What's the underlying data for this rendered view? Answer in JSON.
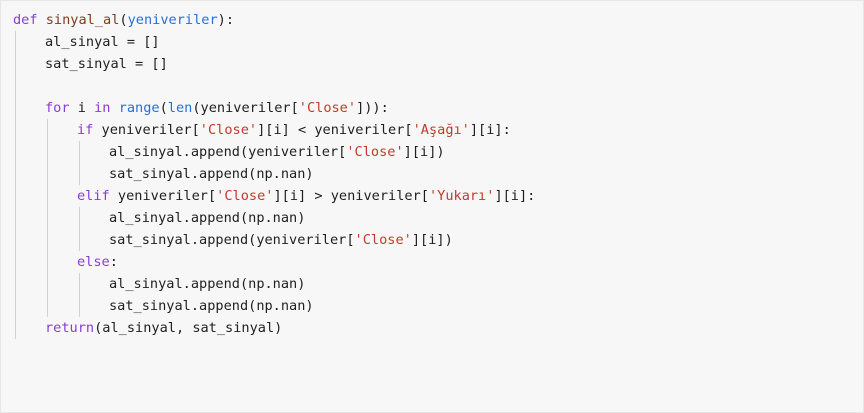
{
  "editor": {
    "language": "python",
    "theme": {
      "background": "#f7f7f7",
      "keyword": "#8a3ed1",
      "function_name": "#7a3e1e",
      "builtin": "#2a6fd6",
      "string": "#c03a2b",
      "text": "#1f1f1f"
    },
    "lines": [
      {
        "indent": 0,
        "tokens": [
          {
            "t": "def",
            "c": "kw"
          },
          {
            "t": " ",
            "c": "pl"
          },
          {
            "t": "sinyal_al",
            "c": "fn"
          },
          {
            "t": "(",
            "c": "pl"
          },
          {
            "t": "yeniveriler",
            "c": "bi"
          },
          {
            "t": "):",
            "c": "pl"
          }
        ]
      },
      {
        "indent": 1,
        "tokens": [
          {
            "t": "al_sinyal = []",
            "c": "pl"
          }
        ]
      },
      {
        "indent": 1,
        "tokens": [
          {
            "t": "sat_sinyal = []",
            "c": "pl"
          }
        ]
      },
      {
        "indent": 1,
        "tokens": []
      },
      {
        "indent": 1,
        "tokens": [
          {
            "t": "for",
            "c": "kw"
          },
          {
            "t": " i ",
            "c": "pl"
          },
          {
            "t": "in",
            "c": "kw"
          },
          {
            "t": " ",
            "c": "pl"
          },
          {
            "t": "range",
            "c": "bi"
          },
          {
            "t": "(",
            "c": "pl"
          },
          {
            "t": "len",
            "c": "bi"
          },
          {
            "t": "(yeniveriler[",
            "c": "pl"
          },
          {
            "t": "'Close'",
            "c": "st"
          },
          {
            "t": "])):",
            "c": "pl"
          }
        ]
      },
      {
        "indent": 2,
        "tokens": [
          {
            "t": "if",
            "c": "kw"
          },
          {
            "t": " yeniveriler[",
            "c": "pl"
          },
          {
            "t": "'Close'",
            "c": "st"
          },
          {
            "t": "][i] < yeniveriler[",
            "c": "pl"
          },
          {
            "t": "'Aşağı'",
            "c": "st"
          },
          {
            "t": "][i]:",
            "c": "pl"
          }
        ]
      },
      {
        "indent": 3,
        "tokens": [
          {
            "t": "al_sinyal.append(yeniveriler[",
            "c": "pl"
          },
          {
            "t": "'Close'",
            "c": "st"
          },
          {
            "t": "][i])",
            "c": "pl"
          }
        ]
      },
      {
        "indent": 3,
        "tokens": [
          {
            "t": "sat_sinyal.append(np.nan)",
            "c": "pl"
          }
        ]
      },
      {
        "indent": 2,
        "tokens": [
          {
            "t": "elif",
            "c": "kw"
          },
          {
            "t": " yeniveriler[",
            "c": "pl"
          },
          {
            "t": "'Close'",
            "c": "st"
          },
          {
            "t": "][i] > yeniveriler[",
            "c": "pl"
          },
          {
            "t": "'Yukarı'",
            "c": "st"
          },
          {
            "t": "][i]:",
            "c": "pl"
          }
        ]
      },
      {
        "indent": 3,
        "tokens": [
          {
            "t": "al_sinyal.append(np.nan)",
            "c": "pl"
          }
        ]
      },
      {
        "indent": 3,
        "tokens": [
          {
            "t": "sat_sinyal.append(yeniveriler[",
            "c": "pl"
          },
          {
            "t": "'Close'",
            "c": "st"
          },
          {
            "t": "][i])",
            "c": "pl"
          }
        ]
      },
      {
        "indent": 2,
        "tokens": [
          {
            "t": "else",
            "c": "kw"
          },
          {
            "t": ":",
            "c": "pl"
          }
        ]
      },
      {
        "indent": 3,
        "tokens": [
          {
            "t": "al_sinyal.append(np.nan)",
            "c": "pl"
          }
        ]
      },
      {
        "indent": 3,
        "tokens": [
          {
            "t": "sat_sinyal.append(np.nan)",
            "c": "pl"
          }
        ]
      },
      {
        "indent": 1,
        "tokens": [
          {
            "t": "return",
            "c": "kw"
          },
          {
            "t": "(al_sinyal, sat_sinyal)",
            "c": "pl"
          }
        ]
      }
    ]
  }
}
